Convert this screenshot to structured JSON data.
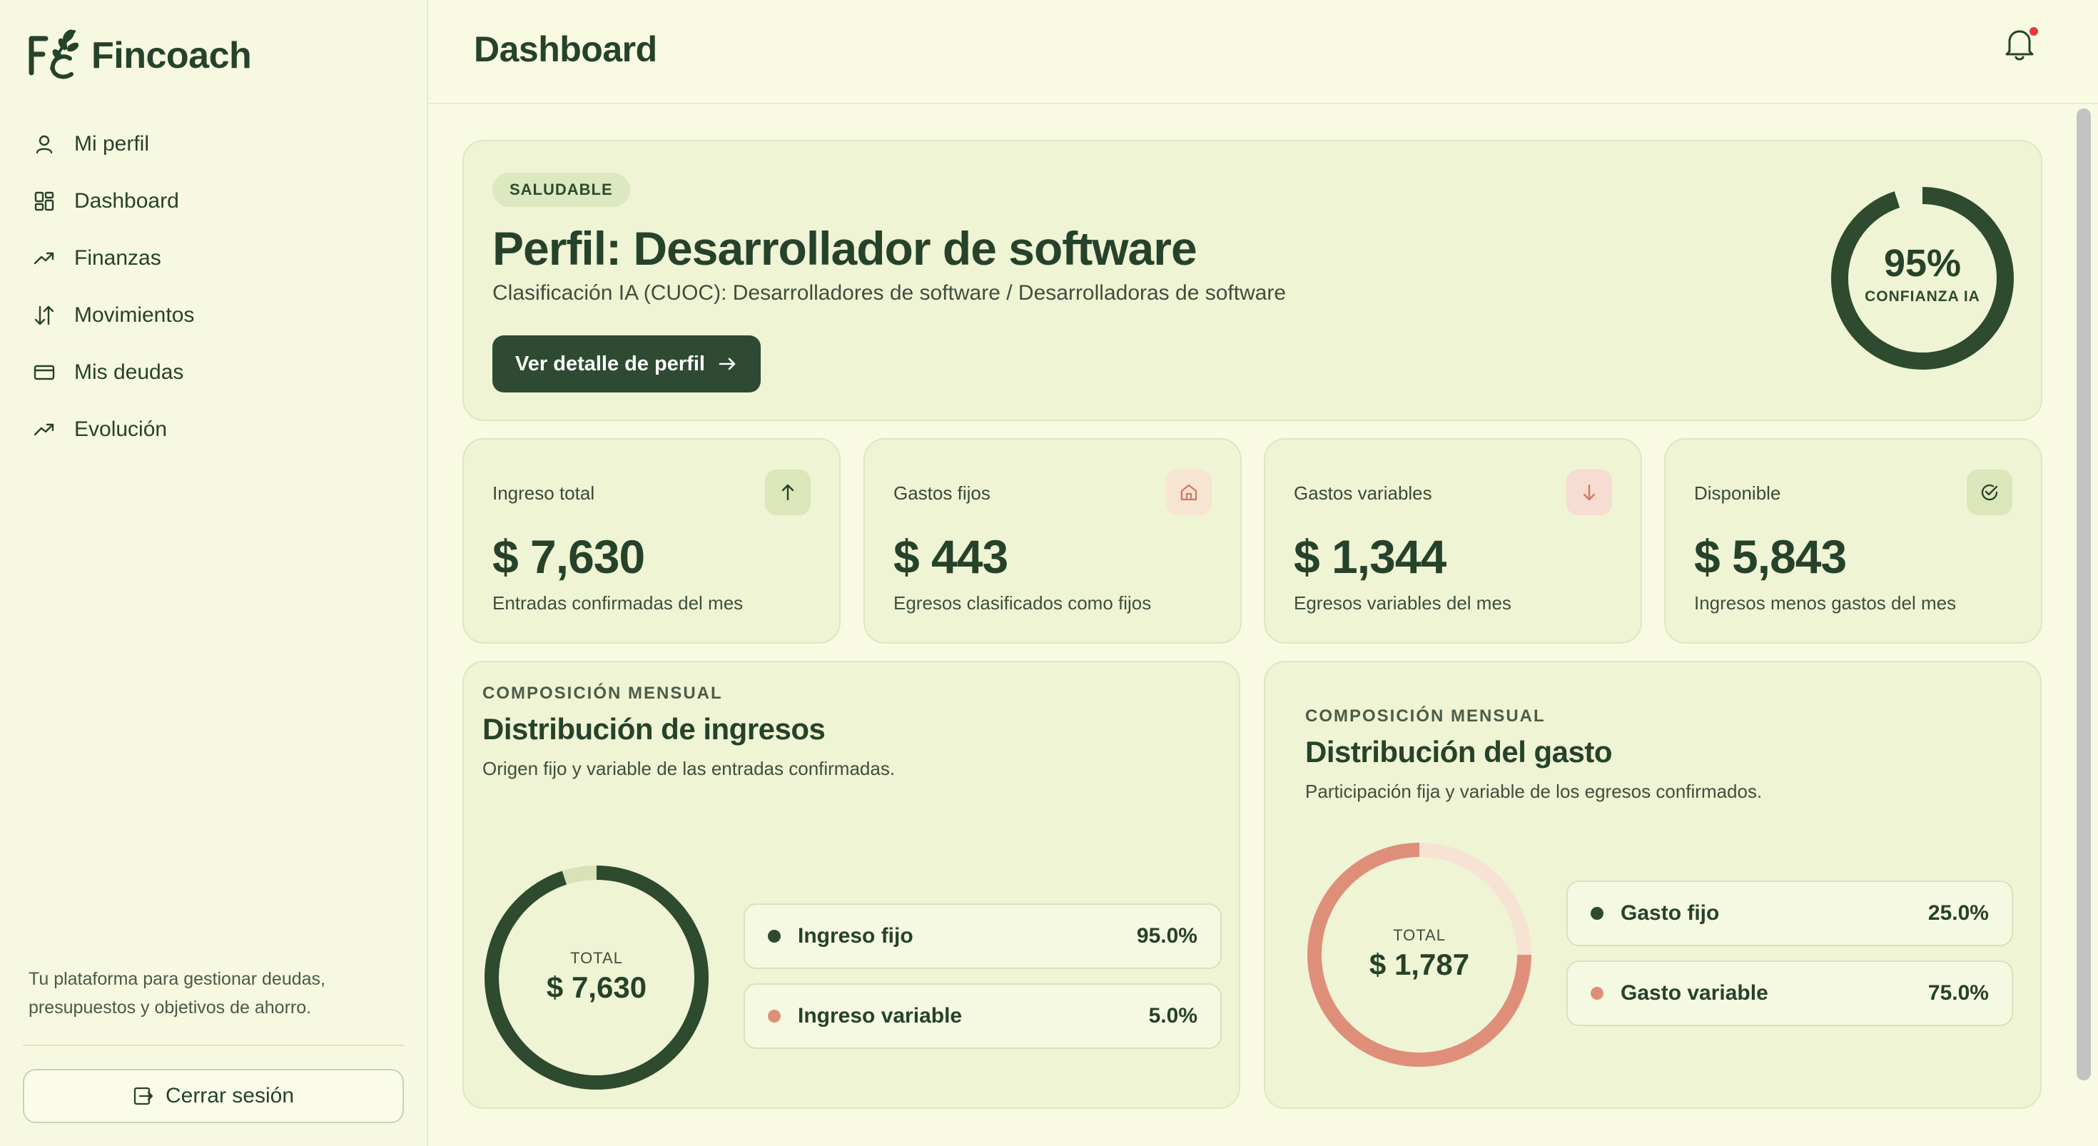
{
  "brand": {
    "name": "Fincoach"
  },
  "sidebar": {
    "items": [
      {
        "label": "Mi perfil",
        "icon": "user-icon"
      },
      {
        "label": "Dashboard",
        "icon": "grid-icon"
      },
      {
        "label": "Finanzas",
        "icon": "trend-up-icon"
      },
      {
        "label": "Movimientos",
        "icon": "arrows-up-down-icon"
      },
      {
        "label": "Mis deudas",
        "icon": "credit-card-icon"
      },
      {
        "label": "Evolución",
        "icon": "trend-up-icon"
      }
    ],
    "footer_text": "Tu plataforma para gestionar deudas, presupuestos y objetivos de ahorro.",
    "logout_label": "Cerrar sesión"
  },
  "header": {
    "title": "Dashboard",
    "has_notification": true
  },
  "hero": {
    "badge": "SALUDABLE",
    "title": "Perfil: Desarrollador de software",
    "subtitle": "Clasificación IA (CUOC): Desarrolladores de software / Desarrolladoras de software",
    "button_label": "Ver detalle de perfil",
    "confidence_value": 0.95,
    "confidence_text": "95%",
    "confidence_label": "CONFIANZA IA"
  },
  "stats": [
    {
      "label": "Ingreso total",
      "value": "$ 7,630",
      "description": "Entradas confirmadas del mes",
      "icon": "arrow-up-icon"
    },
    {
      "label": "Gastos fijos",
      "value": "$ 443",
      "description": "Egresos clasificados como fijos",
      "icon": "home-icon"
    },
    {
      "label": "Gastos variables",
      "value": "$ 1,344",
      "description": "Egresos variables del mes",
      "icon": "arrow-down-icon"
    },
    {
      "label": "Disponible",
      "value": "$ 5,843",
      "description": "Ingresos menos gastos del mes",
      "icon": "check-circle-icon"
    }
  ],
  "income_distribution": {
    "eyebrow": "COMPOSICIÓN MENSUAL",
    "title": "Distribución de ingresos",
    "subtitle": "Origen fijo y variable de las entradas confirmadas.",
    "total_label": "TOTAL",
    "total_value": "$ 7,630",
    "items": [
      {
        "label": "Ingreso fijo",
        "pct": "95.0%",
        "value": 95.0,
        "color": "#2e4a2f"
      },
      {
        "label": "Ingreso variable",
        "pct": "5.0%",
        "value": 5.0,
        "color": "#d7e2b7"
      }
    ]
  },
  "expense_distribution": {
    "eyebrow": "COMPOSICIÓN MENSUAL",
    "title": "Distribución del gasto",
    "subtitle": "Participación fija y variable de los egresos confirmados.",
    "total_label": "TOTAL",
    "total_value": "$ 1,787",
    "items": [
      {
        "label": "Gasto fijo",
        "pct": "25.0%",
        "value": 25.0,
        "color": "#f7e3d3"
      },
      {
        "label": "Gasto variable",
        "pct": "75.0%",
        "value": 75.0,
        "color": "#df8f79"
      }
    ]
  },
  "colors": {
    "primary": "#26422a",
    "background": "#f8fae2",
    "card": "#eff4d5",
    "accent_green_light": "#dce8bf",
    "accent_salmon": "#df8f79",
    "notification": "#e53935"
  }
}
